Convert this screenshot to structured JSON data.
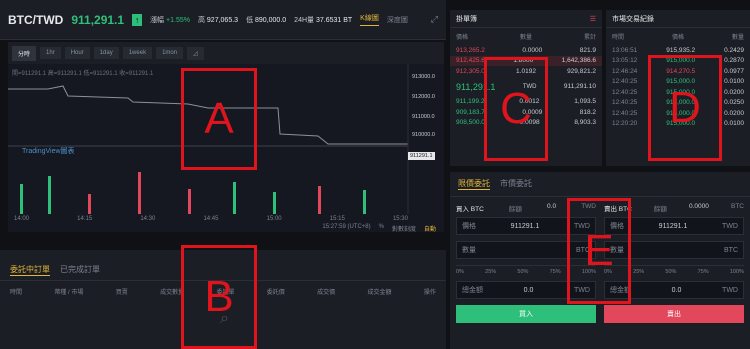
{
  "header": {
    "pair": "BTC/TWD",
    "price": "911,291.1",
    "change_label": "漲幅",
    "change_value": "+1.55%",
    "high_label": "高",
    "high_value": "927,065.3",
    "low_label": "低",
    "low_value": "890,000.0",
    "vol_label": "24H量",
    "vol_value": "37.6531 BT",
    "tab_kline": "K線圖",
    "tab_depth": "深度圖"
  },
  "chart": {
    "timeframes": [
      "分時",
      "1hr",
      "Hour",
      "1day",
      "1week",
      "1mon"
    ],
    "legend": "開=911291.1 高=911291.1 低=911291.1 收=911291.1",
    "watermark": "TradingView圖表",
    "yticks": [
      "913000.0",
      "912000.0",
      "911000.0",
      "910000.0"
    ],
    "last_price": "911291.1",
    "xticks": [
      "14:00",
      "14:15",
      "14:30",
      "14:45",
      "15:00",
      "15:15",
      "15:30"
    ],
    "timestamp": "15:27:59 (UTC+8)",
    "percent": "%",
    "log": "對數刻度",
    "auto": "自動"
  },
  "orderbook": {
    "title": "掛單簿",
    "headers": [
      "價格",
      "數量",
      "累計"
    ],
    "asks": [
      [
        "913,265.2",
        "0.0000",
        "821.9"
      ],
      [
        "912,425.6",
        "1.8000",
        "1,642,386.6"
      ],
      [
        "912,305.0",
        "1.0192",
        "929,821.2"
      ]
    ],
    "mid_price": "911,291.1",
    "mid_unit": "TWD",
    "mid_value": "911,291.10",
    "bids": [
      [
        "911,199.2",
        "0.0012",
        "1,093.5"
      ],
      [
        "909,183.7",
        "0.0009",
        "818.2"
      ],
      [
        "908,500.0",
        "0.0098",
        "8,903.3"
      ]
    ]
  },
  "trades": {
    "title": "市場交易紀錄",
    "headers": [
      "時間",
      "價格",
      "數量"
    ],
    "rows": [
      [
        "13:06:51",
        "915,935.2",
        "0.2429"
      ],
      [
        "13:05:12",
        "915,000.0",
        "0.2870"
      ],
      [
        "12:46:24",
        "914,270.5",
        "0.0977"
      ],
      [
        "12:40:25",
        "915,000.0",
        "0.0100"
      ],
      [
        "12:40:25",
        "915,000.0",
        "0.0200"
      ],
      [
        "12:40:25",
        "915,000.0",
        "0.0250"
      ],
      [
        "12:40:25",
        "915,000.0",
        "0.0200"
      ],
      [
        "12:20:20",
        "915,000.0",
        "0.0100"
      ]
    ]
  },
  "tradeform": {
    "tab_limit": "限價委託",
    "tab_market": "市價委託",
    "buy_label": "買入 BTC",
    "sell_label": "賣出 BTC",
    "balance_label": "餘額",
    "buy_balance": "0.0",
    "buy_unit": "TWD",
    "sell_balance": "0.0000",
    "sell_unit": "BTC",
    "price_label": "價格",
    "price_value": "911291.1",
    "price_unit": "TWD",
    "qty_label": "數量",
    "qty_unit": "BTC",
    "pcts": [
      "0%",
      "25%",
      "50%",
      "75%",
      "100%"
    ],
    "total_label": "總金額",
    "total_value": "0.0",
    "total_unit": "TWD",
    "buy_btn": "買入",
    "sell_btn": "賣出"
  },
  "orders": {
    "tab_open": "委託中訂單",
    "tab_done": "已完成訂單",
    "headers": [
      "時間",
      "幣種 / 市場",
      "買賣",
      "成交數量",
      "委託單",
      "委託價",
      "成交價",
      "成交金額",
      "操作"
    ]
  },
  "annotations": {
    "a": "A",
    "b": "B",
    "c": "C",
    "d": "D",
    "e": "E"
  },
  "colors": {
    "green": "#2ec07a",
    "red": "#e2475b",
    "gold": "#e2b53b",
    "box": "#e0141d"
  }
}
